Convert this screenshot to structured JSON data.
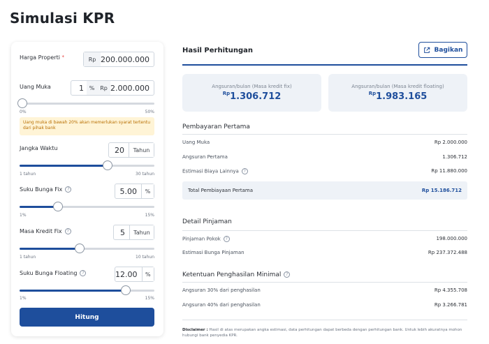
{
  "page": {
    "title": "Simulasi KPR"
  },
  "form": {
    "harga": {
      "label": "Harga Properti",
      "required_mark": "*",
      "unit": "Rp",
      "value": "200.000.000"
    },
    "uang_muka": {
      "label": "Uang Muka",
      "percent": "1",
      "percent_unit": "%",
      "unit": "Rp",
      "value": "2.000.000",
      "min": "0%",
      "max": "50%",
      "slider_fraction": 0.02,
      "warning": "Uang muka di bawah 20% akan memerlukan syarat tertentu dari pihak bank"
    },
    "jangka": {
      "label": "Jangka Waktu",
      "value": "20",
      "unit": "Tahun",
      "min": "1 tahun",
      "max": "30 tahun",
      "slider_fraction": 0.655
    },
    "bunga_fix": {
      "label": "Suku Bunga Fix",
      "value": "5.00",
      "unit": "%",
      "min": "1%",
      "max": "15%",
      "slider_fraction": 0.286
    },
    "masa_fix": {
      "label": "Masa Kredit Fix",
      "value": "5",
      "unit": "Tahun",
      "min": "1 tahun",
      "max": "10 tahun",
      "slider_fraction": 0.444
    },
    "bunga_floating": {
      "label": "Suku Bunga Floating",
      "value": "12.00",
      "unit": "%",
      "min": "1%",
      "max": "15%",
      "slider_fraction": 0.786
    },
    "submit_label": "Hitung"
  },
  "result": {
    "title": "Hasil Perhitungan",
    "share_label": "Bagikan",
    "fix": {
      "label": "Angsuran/bulan (Masa kredit fix)",
      "currency": "Rp",
      "value": "1.306.712"
    },
    "floating": {
      "label": "Angsuran/bulan (Masa kredit floating)",
      "currency": "Rp",
      "value": "1.983.165"
    },
    "pembayaran": {
      "title": "Pembayaran Pertama",
      "rows": [
        {
          "label": "Uang Muka",
          "value": "Rp 2.000.000"
        },
        {
          "label": "Angsuran Pertama",
          "value": "1.306.712"
        },
        {
          "label": "Estimasi Biaya Lainnya",
          "value": "Rp 11.880.000"
        }
      ],
      "total_label": "Total Pembiayaan Pertama",
      "total_value": "Rp 15.186.712"
    },
    "pinjaman": {
      "title": "Detail Pinjaman",
      "rows": [
        {
          "label": "Pinjaman Pokok",
          "value": "198.000.000"
        },
        {
          "label": "Estimasi Bunga Pinjaman",
          "value": "Rp 237.372.488"
        }
      ]
    },
    "penghasilan": {
      "title": "Ketentuan Penghasilan Minimal",
      "rows": [
        {
          "label": "Angsuran 30% dari penghasilan",
          "value": "Rp 4.355.708"
        },
        {
          "label": "Angsuran 40% dari penghasilan",
          "value": "Rp 3.266.781"
        }
      ]
    },
    "disclaimer_label": "Disclaimer :",
    "disclaimer_text": "Hasil di atas merupakan angka estimasi, data perhitungan dapat berbeda dengan perhitungan bank. Untuk lebih akuratnya mohon hubungi bank penyedia KPR."
  },
  "colors": {
    "primary": "#1e4e9c",
    "warning_bg": "#fff4d6",
    "warning_text": "#b76e00",
    "result_bg": "#eef2f7"
  }
}
